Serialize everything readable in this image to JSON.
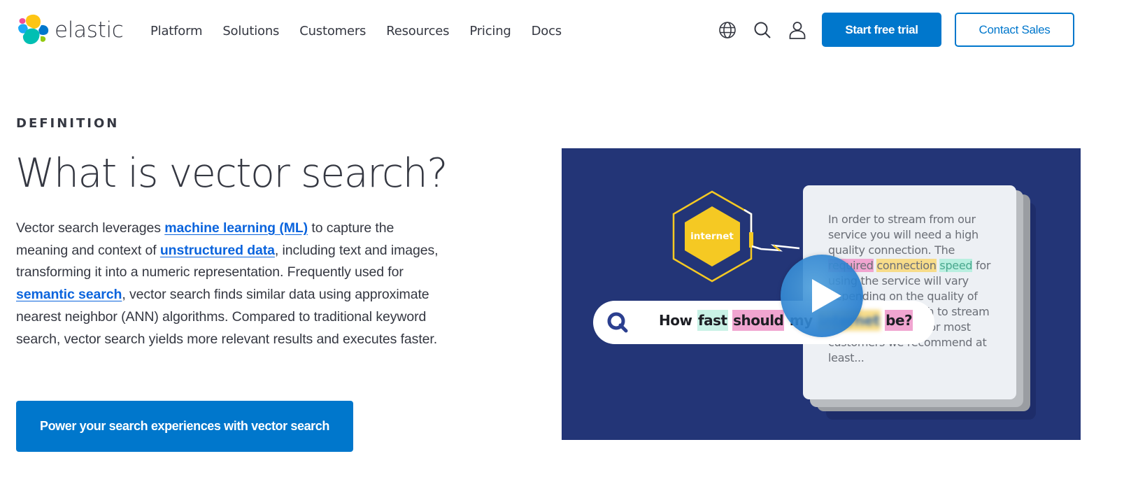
{
  "header": {
    "logo_text": "elastic",
    "nav": [
      {
        "label": "Platform"
      },
      {
        "label": "Solutions"
      },
      {
        "label": "Customers"
      },
      {
        "label": "Resources"
      },
      {
        "label": "Pricing"
      },
      {
        "label": "Docs"
      }
    ],
    "icons": [
      "globe-icon",
      "search-icon",
      "user-icon"
    ],
    "start_trial_label": "Start free trial",
    "contact_sales_label": "Contact Sales"
  },
  "hero": {
    "eyebrow": "DEFINITION",
    "title": "What is vector search?",
    "body": {
      "seg1": "Vector search leverages ",
      "link1": "machine learning (ML)",
      "seg2": " to capture the meaning and context of ",
      "link2": "unstructured data",
      "seg3": ", including text and images, transforming it into a numeric representation. Frequently used for ",
      "link3": "semantic search",
      "seg4": ", vector search finds similar data using approximate nearest neighbor (ANN) algorithms. Compared to traditional keyword search, vector search yields more relevant results and executes faster."
    },
    "cta_label": "Power your search experiences with vector search"
  },
  "video": {
    "hexagon_label": "internet",
    "search_query": {
      "w1": "How",
      "w2": "fast",
      "w3": "should",
      "w4": "my",
      "w5": "internet",
      "w6": "be?"
    },
    "card": {
      "line1": "In order to stream from our service you will need a high quality connection. The ",
      "hl_required": "required",
      "hl_connection": "connection",
      "hl_speed": "speed",
      "line2": " for using the service will vary depending on the quality of video that you wish to stream from our service. For most customers we recommend at least..."
    },
    "colors": {
      "background": "#233577",
      "hex_yellow": "#f5c923",
      "play_blue": "#1e78c8"
    }
  },
  "colors": {
    "brand_blue": "#0077cc",
    "link_blue": "#0b64dd",
    "text": "#343741"
  }
}
